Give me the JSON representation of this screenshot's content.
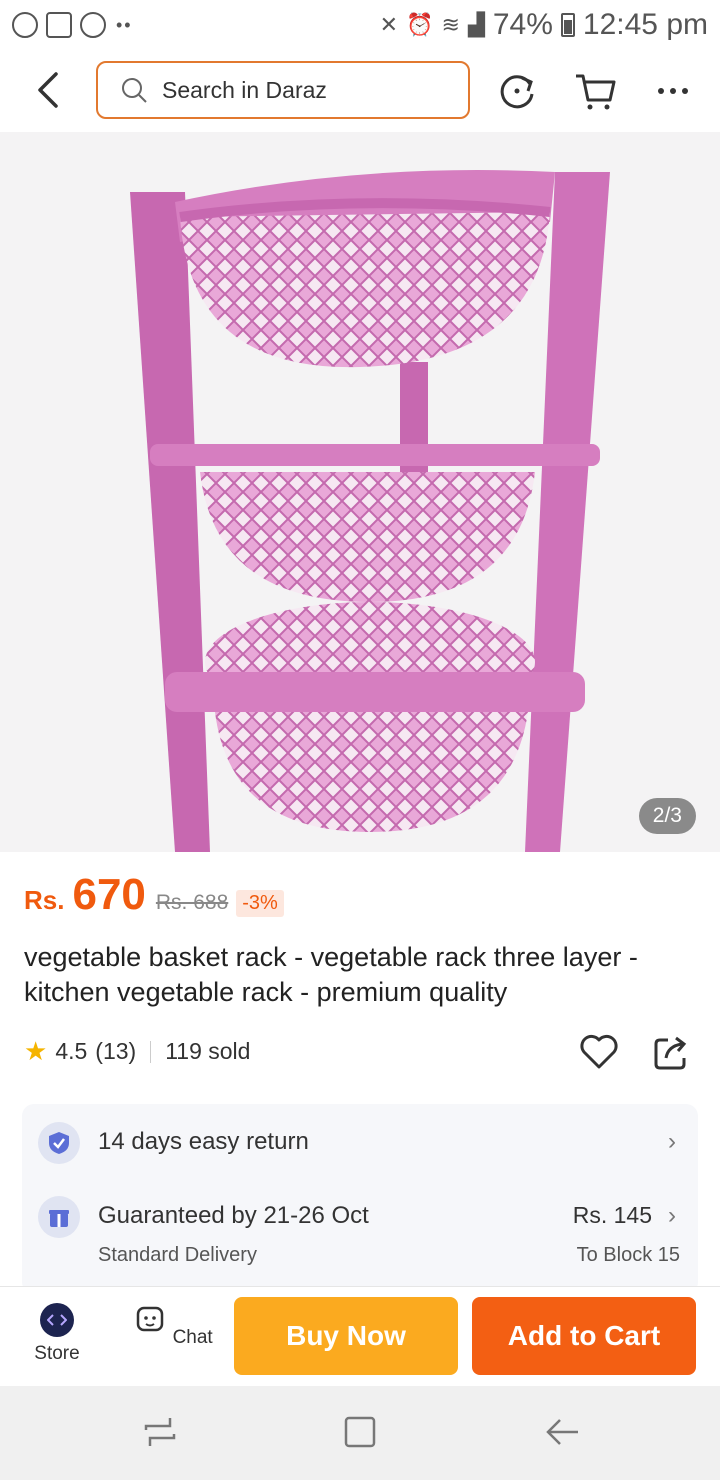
{
  "status_bar": {
    "battery": "74%",
    "time": "12:45 pm"
  },
  "header": {
    "search_placeholder": "Search in Daraz"
  },
  "gallery": {
    "counter": "2/3"
  },
  "product": {
    "currency": "Rs.",
    "price": "670",
    "original_price": "Rs. 688",
    "discount": "-3%",
    "title": "vegetable basket rack - vegetable rack three layer - kitchen vegetable rack - premium quality",
    "rating": "4.5",
    "rating_count": "(13)",
    "sold": "119 sold"
  },
  "services": {
    "return_text": "14 days easy return",
    "delivery_text": "Guaranteed by 21-26 Oct",
    "delivery_type": "Standard Delivery",
    "delivery_fee": "Rs. 145",
    "delivery_location": "To Block 15"
  },
  "actions": {
    "store_label": "Store",
    "chat_label": "Chat",
    "buy_now": "Buy Now",
    "add_to_cart": "Add to Cart"
  },
  "colors": {
    "accent": "#f05a0e",
    "buy_now": "#fbaa1f",
    "add_to_cart": "#f35f13",
    "product_pink": "#d175b8"
  }
}
